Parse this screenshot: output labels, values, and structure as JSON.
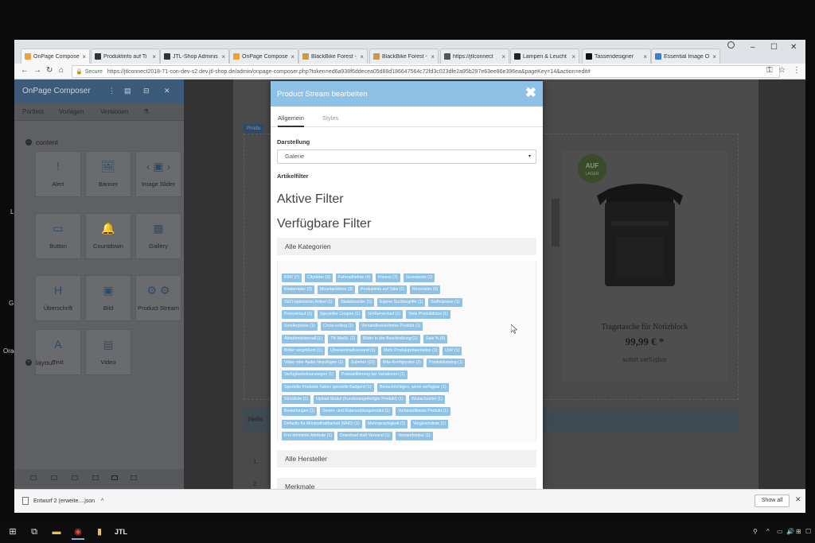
{
  "edge_left": [
    "L",
    "G",
    "Orac"
  ],
  "browser": {
    "tabs": [
      {
        "label": "OnPage Composer",
        "color": "#e8a33a"
      },
      {
        "label": "Produktinfo auf Ti",
        "color": "#333333"
      },
      {
        "label": "JTL-Shop Adminis",
        "color": "#333333"
      },
      {
        "label": "OnPage Composer",
        "color": "#e8a33a"
      },
      {
        "label": "BlackBike Forest -",
        "color": "#c89a4a"
      },
      {
        "label": "BlackBike Forest -",
        "color": "#c89a4a"
      },
      {
        "label": "https://jtlconnect",
        "color": "#555555"
      },
      {
        "label": "Lampen & Leucht",
        "color": "#222222"
      },
      {
        "label": "Tassendesigner",
        "color": "#111111"
      },
      {
        "label": "Essential Image O",
        "color": "#3a7bd5"
      }
    ],
    "tab_close": "×",
    "window_controls": {
      "minimize": "–",
      "maximize": "☐",
      "close": "✕"
    },
    "nav": {
      "back": "←",
      "forward": "→",
      "reload": "↻",
      "home": "⌂"
    },
    "secure_label": "Secure",
    "url": "https://jtlconnect2018-71-con-dev-s2.dev.jtl-shop.de/admin/onpage-composer.php?token=ed6a938f6ddecea05d88d186647564c72fd3c023dfe2a95b297e63ee86e396ea&pageKey=14&action=edit#",
    "addr_icons": {
      "key": "⚿",
      "star": "☆",
      "menu": "⋮"
    }
  },
  "sidebar": {
    "title": "OnPage Composer",
    "tool_icons": [
      "⋮",
      "▤",
      "⊟",
      "✕"
    ],
    "tabs": [
      "Portlets",
      "Vorlagen",
      "Versionen",
      "⚗"
    ],
    "section_content": "content",
    "section_layout": "layout",
    "section_marks": {
      "content": "–",
      "layout": "+"
    },
    "portlets": [
      {
        "label": "Alert",
        "icon": "!"
      },
      {
        "label": "Banner",
        "icon": "🖼"
      },
      {
        "label": "Image Slider",
        "icon": "‹ ▣ ›"
      },
      {
        "label": "Button",
        "icon": "▭"
      },
      {
        "label": "Countdown",
        "icon": "🔔"
      },
      {
        "label": "Gallery",
        "icon": "▦"
      },
      {
        "label": "Überschrift",
        "icon": "H"
      },
      {
        "label": "Bild",
        "icon": "▣"
      },
      {
        "label": "Product Stream",
        "icon": "⚙ ⚙"
      },
      {
        "label": "Text",
        "icon": "A"
      },
      {
        "label": "Video",
        "icon": "▤"
      }
    ]
  },
  "page": {
    "stream_label": "Produ",
    "product": {
      "badge_main": "AUF",
      "badge_sub": "LAGER",
      "title": "Tragetasche für Notizblock",
      "price": "99,99 € *",
      "availability": "sofort verfügbar"
    },
    "hello_text": "Hello",
    "list_numbers": [
      "1.",
      "2."
    ]
  },
  "modal": {
    "title": "Product Stream bearbeiten",
    "close": "✖",
    "tabs": [
      "Allgemein",
      "Styles"
    ],
    "darstellung_label": "Darstellung",
    "darstellung_value": "Galerie",
    "select_caret": "▾",
    "artikelfilter_label": "Artikelfilter",
    "aktive_filter": "Aktive Filter",
    "verfuegbare_filter": "Verfügbare Filter",
    "accordion": [
      "Alle Kategorien",
      "Alle Hersteller",
      "Merkmale"
    ],
    "chips": [
      [
        "BMX (7)",
        "Cityräder (3)",
        "Fahrradhelme (4)",
        "Fitness (7)",
        "Grundpreis (1)"
      ],
      [
        "Kinderräder (3)",
        "Mountainbikes (3)",
        "Produktinfo auf Tabs (1)",
        "Rennräder (6)"
      ],
      [
        "SEO-optimierter Artikel (1)",
        "Skateboarder (1)",
        "Eigene Suchbegriffe (1)",
        "Staffelpreise (1)"
      ],
      [
        "Preisverlauf (1)",
        "Spezieller Coupon (1)",
        "Größenverlauf (1)",
        "Viele Produktfotos (1)"
      ],
      [
        "Sonderpreise (1)",
        "Cross-selling (1)",
        "Versandkostenfreies Produkt (1)"
      ],
      [
        "Abnahmeintervall (1)",
        "7% MwSt. (1)",
        "Bilder in der Beschreibung (1)",
        "Sale % (6)"
      ],
      [
        "Bilder vergrößern (1)",
        "Uhrenschnellversand (1)",
        "Mehr Produktpräsentation (1)",
        "UVP (1)"
      ],
      [
        "Video oder Audio hinzufügen (1)",
        "Zubehör (10)",
        "Bike-Konfigurator (2)",
        "Produktkatalog (1)"
      ],
      [
        "Verfügbarkeitsanzeigen (1)",
        "Preisabfilterung bei Variationen (1)"
      ],
      [
        "Spezielle Produkte haben spezielle Badgerd (1)",
        "Benachrichtigen, wenn verfügbar (1)"
      ],
      [
        "Stückliste (1)",
        "Upload-Modul (Kundenangefertigte Produkt) (1)",
        "Wunschzettel (1)"
      ],
      [
        "Bewertungen (1)",
        "Serien- und Ratenzahlungsmodul (1)",
        "Vorbestellbares Produkt (1)"
      ],
      [
        "Defaults für Mindesthaltbarkeit (MHD) (1)",
        "Mehrsprachigkeit (1)",
        "Vergleichsliste (1)"
      ],
      [
        "Frei definierte Attribute (1)",
        "Download statt Versand (1)",
        "Versandstatus (1)"
      ]
    ]
  },
  "downloads": {
    "file": "Entwurf 2 (erweite....json",
    "chevron": "^",
    "show_all": "Show all",
    "close": "✕"
  },
  "taskbar": {
    "start": "⊞",
    "taskview": "⧉",
    "explorer": "▬",
    "chrome": "◉",
    "app4": "▮",
    "jtl": "JTL",
    "tray": [
      "⚲",
      "^",
      "▭",
      "🔊",
      "⊞",
      "☐"
    ]
  }
}
